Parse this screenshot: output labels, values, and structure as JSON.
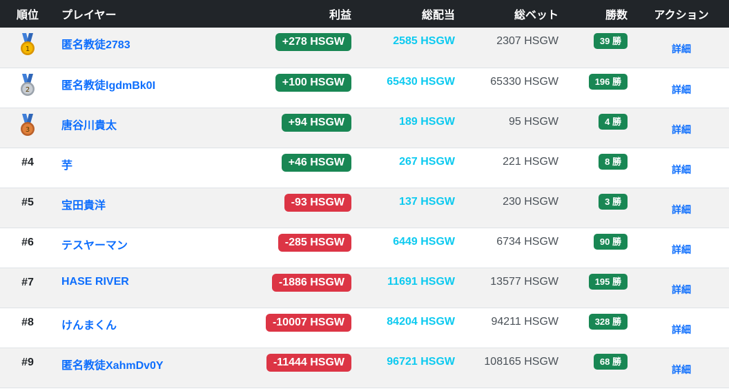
{
  "colors": {
    "header_bg": "#212529",
    "positive": "#198754",
    "negative": "#dc3545",
    "link": "#0d6efd",
    "payout": "#0dcaf0"
  },
  "headers": {
    "rank": "順位",
    "player": "プレイヤー",
    "profit": "利益",
    "payout": "総配当",
    "bet": "総ベット",
    "wins": "勝数",
    "action": "アクション"
  },
  "rows": [
    {
      "rank": "",
      "medal": "gold-medal-icon",
      "player": "匿名教徒2783",
      "profit": "+278 HSGW",
      "profit_sign": "pos",
      "payout": "2585 HSGW",
      "bet": "2307 HSGW",
      "wins": "39 勝",
      "action": "詳細"
    },
    {
      "rank": "",
      "medal": "silver-medal-icon",
      "player": "匿名教徒lgdmBk0I",
      "profit": "+100 HSGW",
      "profit_sign": "pos",
      "payout": "65430 HSGW",
      "bet": "65330 HSGW",
      "wins": "196 勝",
      "action": "詳細"
    },
    {
      "rank": "",
      "medal": "bronze-medal-icon",
      "player": "唐谷川貴太",
      "profit": "+94 HSGW",
      "profit_sign": "pos",
      "payout": "189 HSGW",
      "bet": "95 HSGW",
      "wins": "4 勝",
      "action": "詳細"
    },
    {
      "rank": "#4",
      "medal": "",
      "player": "芋",
      "profit": "+46 HSGW",
      "profit_sign": "pos",
      "payout": "267 HSGW",
      "bet": "221 HSGW",
      "wins": "8 勝",
      "action": "詳細"
    },
    {
      "rank": "#5",
      "medal": "",
      "player": "宝田貴洋",
      "profit": "-93 HSGW",
      "profit_sign": "neg",
      "payout": "137 HSGW",
      "bet": "230 HSGW",
      "wins": "3 勝",
      "action": "詳細"
    },
    {
      "rank": "#6",
      "medal": "",
      "player": "テスヤーマン",
      "profit": "-285 HSGW",
      "profit_sign": "neg",
      "payout": "6449 HSGW",
      "bet": "6734 HSGW",
      "wins": "90 勝",
      "action": "詳細"
    },
    {
      "rank": "#7",
      "medal": "",
      "player": "HASE RIVER",
      "profit": "-1886 HSGW",
      "profit_sign": "neg",
      "payout": "11691 HSGW",
      "bet": "13577 HSGW",
      "wins": "195 勝",
      "action": "詳細"
    },
    {
      "rank": "#8",
      "medal": "",
      "player": "けんまくん",
      "profit": "-10007 HSGW",
      "profit_sign": "neg",
      "payout": "84204 HSGW",
      "bet": "94211 HSGW",
      "wins": "328 勝",
      "action": "詳細"
    },
    {
      "rank": "#9",
      "medal": "",
      "player": "匿名教徒XahmDv0Y",
      "profit": "-11444 HSGW",
      "profit_sign": "neg",
      "payout": "96721 HSGW",
      "bet": "108165 HSGW",
      "wins": "68 勝",
      "action": "詳細"
    }
  ]
}
